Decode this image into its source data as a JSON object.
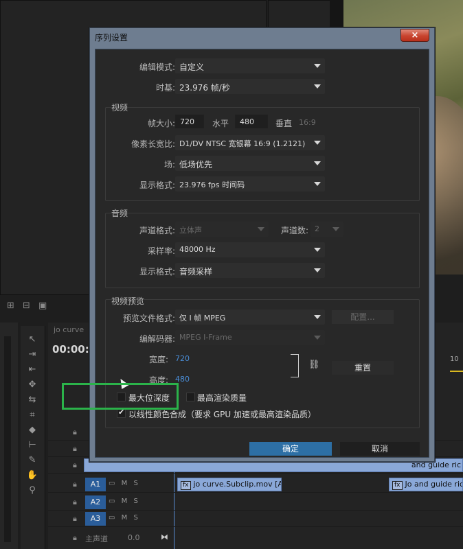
{
  "dialog": {
    "title": "序列设置",
    "close_icon": "×",
    "edit_mode": {
      "label": "编辑模式:",
      "value": "自定义"
    },
    "timebase": {
      "label": "时基:",
      "value": "23.976 帧/秒"
    },
    "video": {
      "section_title": "视频",
      "frame_size_label": "帧大小:",
      "frame_width": "720",
      "horizontal_label": "水平",
      "frame_height": "480",
      "vertical_label": "垂直",
      "aspect": "16:9",
      "pixel_aspect_label": "像素长宽比:",
      "pixel_aspect_value": "D1/DV NTSC 宽银幕 16:9 (1.2121)",
      "fields_label": "场:",
      "fields_value": "低场优先",
      "display_format_label": "显示格式:",
      "display_format_value": "23.976 fps 时间码"
    },
    "audio": {
      "section_title": "音频",
      "channel_format_label": "声道格式:",
      "channel_format_value": "立体声",
      "channels_label": "声道数:",
      "channels_value": "2",
      "sample_rate_label": "采样率:",
      "sample_rate_value": "48000 Hz",
      "display_format_label": "显示格式:",
      "display_format_value": "音频采样"
    },
    "preview": {
      "section_title": "视频预览",
      "file_format_label": "预览文件格式:",
      "file_format_value": "仅 I 帧 MPEG",
      "configure_button": "配置...",
      "codec_label": "编解码器:",
      "codec_value": "MPEG I-Frame",
      "width_label": "宽度:",
      "width_value": "720",
      "height_label": "高度:",
      "height_value": "480",
      "reset_button": "重置"
    },
    "max_bit_depth": {
      "label": "最大位深度",
      "checked": false
    },
    "max_render_quality": {
      "label": "最高渲染质量",
      "checked": false
    },
    "linear_color": {
      "label": "以线性颜色合成（要求 GPU 加速或最高渲染品质）",
      "checked": true
    },
    "ok_button": "确定",
    "cancel_button": "取消"
  },
  "timeline": {
    "tab_label": "jo curve",
    "timecode": "00:00:0",
    "tracks": [
      {
        "name": "A1",
        "m": "M",
        "s": "S"
      },
      {
        "name": "A2",
        "m": "M",
        "s": "S"
      },
      {
        "name": "A3",
        "m": "M",
        "s": "S"
      }
    ],
    "master_label": "主声道",
    "master_value": "0.0",
    "clips": {
      "a1_clip": "jo curve.Subclip.mov [A]",
      "a1_clip2": "Jo and guide ric",
      "v_clip": "and guide ric",
      "fx": "fx"
    }
  },
  "colors": {
    "accent": "#2d6fa5",
    "highlight": "#2bb34a",
    "track_tag": "#2a5d9a"
  }
}
